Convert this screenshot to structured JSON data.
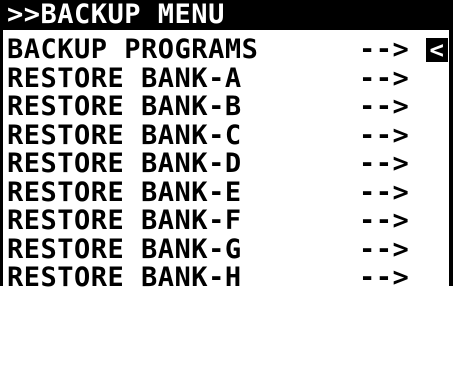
{
  "title": ">>BACKUP MENU",
  "menu": {
    "items": [
      {
        "label": "BACKUP PROGRAMS",
        "arrow": "-->"
      },
      {
        "label": "RESTORE BANK-A",
        "arrow": "-->"
      },
      {
        "label": "RESTORE BANK-B",
        "arrow": "-->"
      },
      {
        "label": "RESTORE BANK-C",
        "arrow": "-->"
      },
      {
        "label": "RESTORE BANK-D",
        "arrow": "-->"
      },
      {
        "label": "RESTORE BANK-E",
        "arrow": "-->"
      },
      {
        "label": "RESTORE BANK-F",
        "arrow": "-->"
      },
      {
        "label": "RESTORE BANK-G",
        "arrow": "-->"
      },
      {
        "label": "RESTORE BANK-H",
        "arrow": "-->"
      }
    ],
    "cursor_glyph": "<"
  },
  "colors": {
    "background": "#ffffff",
    "foreground": "#000000",
    "title_background": "#000000",
    "title_text": "#ffffff"
  }
}
